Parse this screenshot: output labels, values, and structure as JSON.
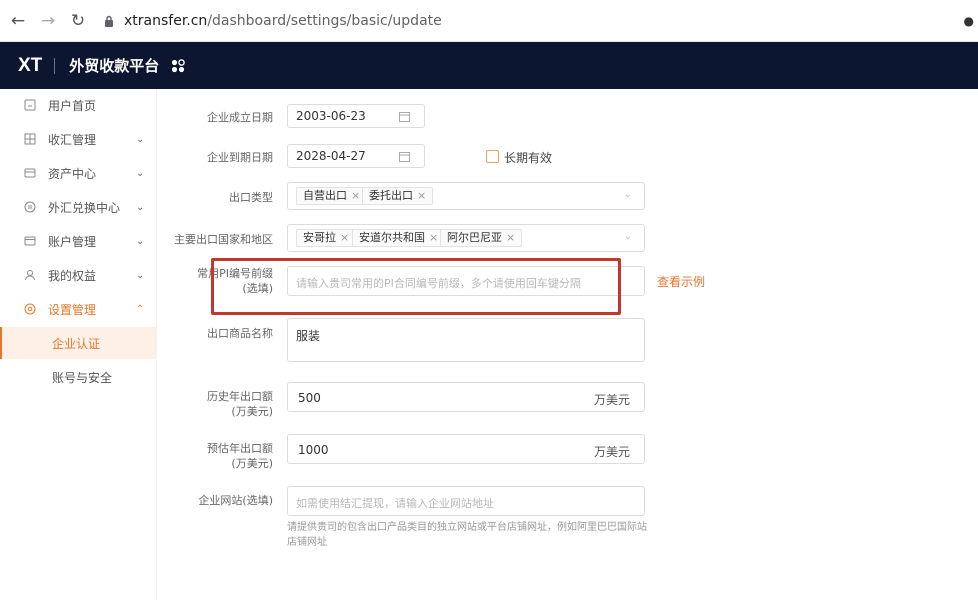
{
  "browser": {
    "url_host": "xtransfer.cn",
    "url_path": "/dashboard/settings/basic/update"
  },
  "header": {
    "logo": "XT",
    "platform_name": "外贸收款平台"
  },
  "sidebar": {
    "items": [
      {
        "label": "用户首页",
        "icon": "home-icon",
        "arrow": ""
      },
      {
        "label": "收汇管理",
        "icon": "receipt-icon",
        "arrow": "⌄"
      },
      {
        "label": "资产中心",
        "icon": "wallet-icon",
        "arrow": "⌄"
      },
      {
        "label": "外汇兑换中心",
        "icon": "exchange-icon",
        "arrow": "⌄"
      },
      {
        "label": "账户管理",
        "icon": "card-icon",
        "arrow": "⌄"
      },
      {
        "label": "我的权益",
        "icon": "user-icon",
        "arrow": "⌄"
      },
      {
        "label": "设置管理",
        "icon": "settings-icon",
        "arrow": "⌃"
      }
    ],
    "sub_items": [
      {
        "label": "企业认证"
      },
      {
        "label": "账号与安全"
      }
    ],
    "accent_color": "#e8762b"
  },
  "form": {
    "establish_date": {
      "label": "企业成立日期",
      "value": "2003-06-23"
    },
    "expire_date": {
      "label": "企业到期日期",
      "value": "2028-04-27"
    },
    "long_term": {
      "label": "长期有效"
    },
    "export_type": {
      "label": "出口类型",
      "tags": [
        "自营出口",
        "委托出口"
      ]
    },
    "export_countries": {
      "label": "主要出口国家和地区",
      "tags": [
        "安哥拉",
        "安道尔共和国",
        "阿尔巴尼亚"
      ]
    },
    "pi_prefix": {
      "label_line1": "常用PI编号前缀",
      "label_line2": "(选填)",
      "placeholder": "请输入贵司常用的PI合同编号前缀，多个请使用回车键分隔",
      "example_link": "查看示例"
    },
    "product_name": {
      "label": "出口商品名称",
      "value": "服装"
    },
    "history_amount": {
      "label_line1": "历史年出口额",
      "label_line2": "(万美元)",
      "value": "500",
      "unit": "万美元"
    },
    "estimate_amount": {
      "label_line1": "预估年出口额",
      "label_line2": "(万美元)",
      "value": "1000",
      "unit": "万美元"
    },
    "website": {
      "label": "企业网站(选填)",
      "placeholder": "如需使用结汇提现，请输入企业网站地址",
      "helper": "请提供贵司的包含出口产品类目的独立网站或平台店铺网址，例如阿里巴巴国际站店铺网址"
    }
  },
  "highlight_color": "#c0392b"
}
